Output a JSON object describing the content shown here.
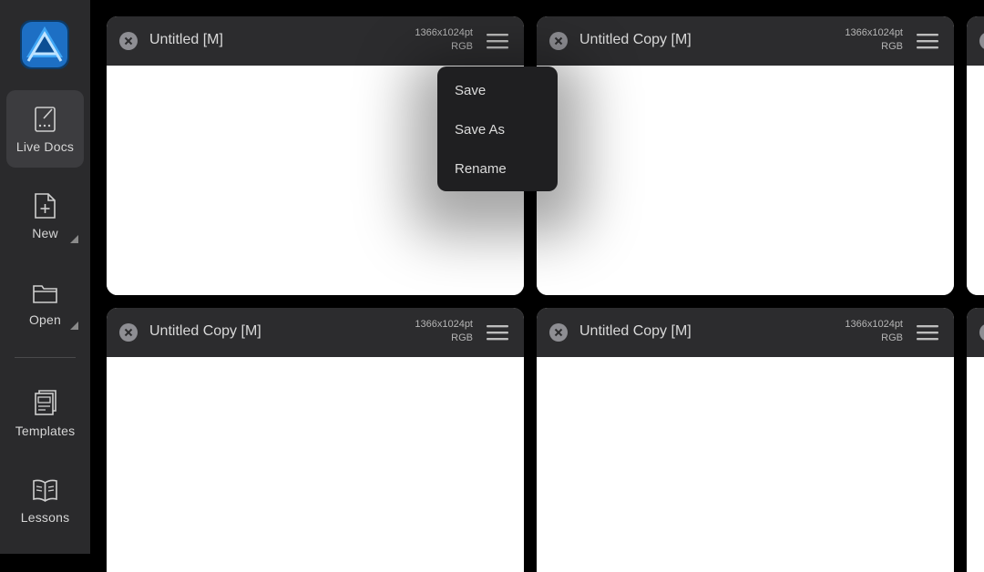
{
  "sidebar": {
    "items": [
      {
        "label": "Live Docs",
        "icon": "live-docs-icon",
        "active": true
      },
      {
        "label": "New",
        "icon": "new-document-icon",
        "active": false
      },
      {
        "label": "Open",
        "icon": "open-folder-icon",
        "active": false
      },
      {
        "label": "Templates",
        "icon": "templates-icon",
        "active": false
      },
      {
        "label": "Lessons",
        "icon": "lessons-book-icon",
        "active": false
      }
    ]
  },
  "documents": [
    {
      "title": "Untitled [M]",
      "size": "1366x1024pt",
      "mode": "RGB"
    },
    {
      "title": "Untitled Copy [M]",
      "size": "1366x1024pt",
      "mode": "RGB"
    },
    {
      "title": "Untitled Copy [M]",
      "size": "1366x1024pt",
      "mode": "RGB"
    },
    {
      "title": "Untitled Copy [M]",
      "size": "1366x1024pt",
      "mode": "RGB"
    }
  ],
  "context_menu": {
    "items": [
      "Save",
      "Save As",
      "Rename"
    ]
  },
  "colors": {
    "sidebar_bg": "#2a2a2c",
    "active_nav_bg": "#3c3c3f",
    "card_header": "#2c2c2e",
    "logo_blue": "#2f9bf0"
  }
}
